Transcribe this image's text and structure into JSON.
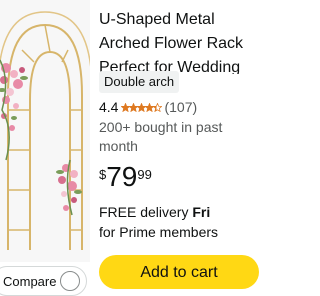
{
  "product": {
    "title_lines": [
      "U-Shaped Metal",
      "Arched Flower Rack",
      "Perfect for Wedding"
    ],
    "variant": "Double arch",
    "rating_value": "4.4",
    "rating_stars": 4.4,
    "rating_count": "(107)",
    "bought_text": "200+ bought in past month",
    "price_symbol": "$",
    "price_whole": "79",
    "price_fraction": "99",
    "delivery_prefix": "FREE delivery",
    "delivery_day": "Fri",
    "delivery_suffix": "for Prime members"
  },
  "actions": {
    "compare_label": "Compare",
    "add_to_cart_label": "Add to cart"
  },
  "colors": {
    "accent_button": "#ffd814",
    "star": "#de7921",
    "arch_gold": "#c9a24a",
    "flower_pink": "#e88aa6"
  }
}
